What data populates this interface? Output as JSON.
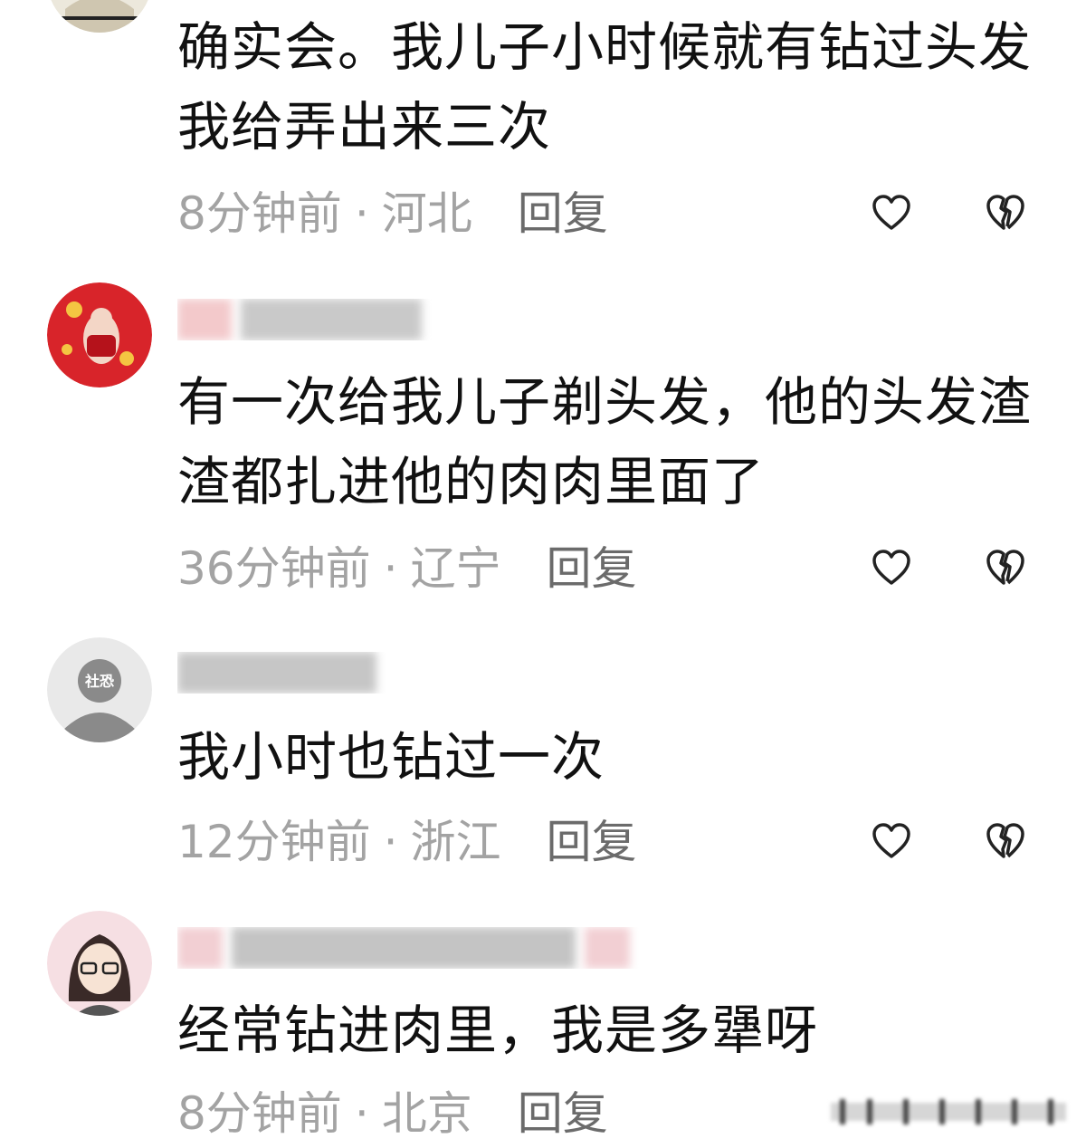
{
  "comments": [
    {
      "text": "确实会。我儿子小时候就有钻过头发我给弄出来三次",
      "time": "8分钟前",
      "location": "河北",
      "reply_label": "回复",
      "avatar": "partial-avatar"
    },
    {
      "text": "有一次给我儿子剃头发，他的头发渣渣都扎进他的肉肉里面了",
      "time": "36分钟前",
      "location": "辽宁",
      "reply_label": "回复",
      "avatar": "red-baby-photo-avatar"
    },
    {
      "text": "我小时也钻过一次",
      "time": "12分钟前",
      "location": "浙江",
      "reply_label": "回复",
      "avatar": "default-grey-avatar",
      "avatar_label": "社恐"
    },
    {
      "text": "经常钻进肉里，我是多犟呀",
      "time": "8分钟前",
      "location": "北京",
      "reply_label": "回复",
      "avatar": "cartoon-girl-avatar"
    }
  ],
  "separator": "·",
  "icons": {
    "like": "heart-outline-icon",
    "dislike": "broken-heart-icon"
  },
  "colors": {
    "text": "#111111",
    "meta": "#a3a3a3",
    "reply": "#6b6b6b",
    "icon": "#222222",
    "red_avatar": "#d8242a"
  }
}
